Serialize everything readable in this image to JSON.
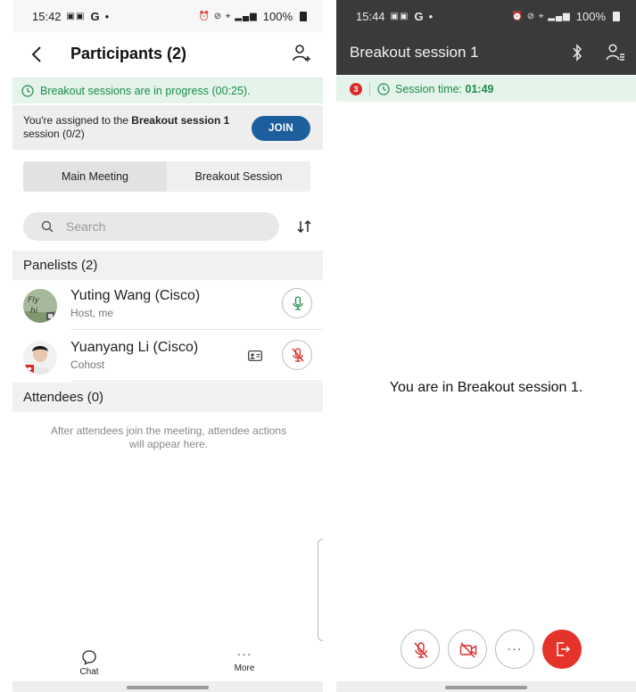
{
  "left": {
    "status": {
      "time": "15:42",
      "carrier": "G",
      "battery": "100%"
    },
    "header": {
      "title": "Participants (2)"
    },
    "banner": {
      "text": "Breakout sessions are in progress (00:25)."
    },
    "assignment": {
      "prefix": "You're assigned to the ",
      "session_name": "Breakout session 1",
      "suffix": "session (0/2)",
      "join_label": "JOIN"
    },
    "tabs": [
      {
        "label": "Main Meeting",
        "active": true
      },
      {
        "label": "Breakout Session",
        "active": false
      }
    ],
    "search": {
      "placeholder": "Search"
    },
    "panelists": {
      "header": "Panelists (2)",
      "items": [
        {
          "name": "Yuting Wang (Cisco)",
          "role": "Host, me",
          "mic": "on",
          "avatar_text": "Fly hi"
        },
        {
          "name": "Yuanyang Li (Cisco)",
          "role": "Cohost",
          "mic": "muted"
        }
      ]
    },
    "attendees": {
      "header": "Attendees (0)",
      "empty_message": "After attendees join the meeting, attendee actions will appear here."
    },
    "bottom_nav": [
      {
        "label": "Chat",
        "icon": "chat-bubble-icon"
      },
      {
        "label": "More",
        "icon": "more-dots-icon"
      }
    ]
  },
  "right": {
    "status": {
      "time": "15:44",
      "carrier": "G",
      "battery": "100%"
    },
    "header": {
      "title": "Breakout session 1"
    },
    "session_bar": {
      "record_badge": "3",
      "label": "Session time: ",
      "time": "01:49"
    },
    "message": "You are in Breakout session 1.",
    "controls": [
      {
        "name": "mute",
        "icon": "mic-muted-icon"
      },
      {
        "name": "video",
        "icon": "video-off-icon"
      },
      {
        "name": "more",
        "icon": "more-dots-icon"
      },
      {
        "name": "leave",
        "icon": "leave-icon"
      }
    ]
  },
  "colors": {
    "accent_green": "#1e8a4c",
    "banner_bg": "#e4f4ea",
    "join_blue": "#1d5f9c",
    "leave_red": "#e5322a",
    "header_dark": "#3a3a3a"
  }
}
